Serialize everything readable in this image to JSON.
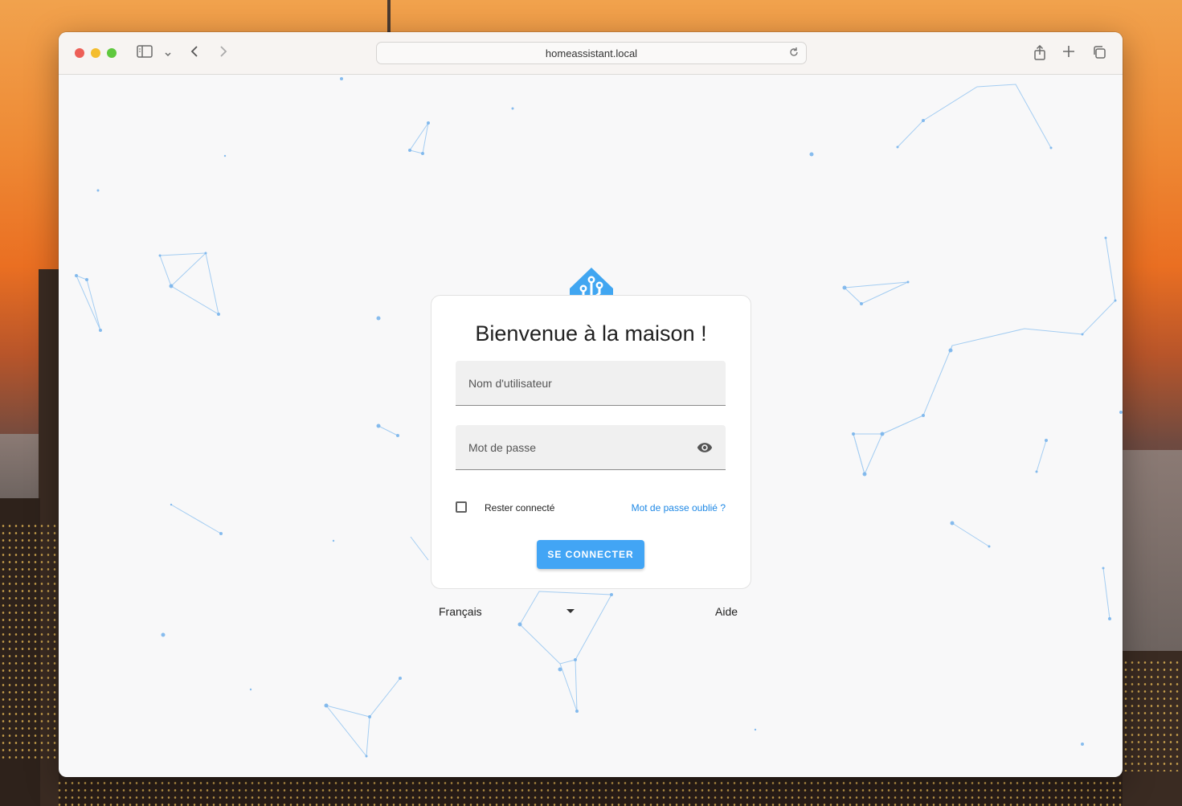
{
  "browser": {
    "url": "homeassistant.local",
    "traffic_lights": {
      "close": "#ed5f57",
      "minimize": "#f4bd2e",
      "zoom": "#5fc83e"
    }
  },
  "login": {
    "title": "Bienvenue à la maison !",
    "username_label": "Nom d'utilisateur",
    "password_label": "Mot de passe",
    "remember_label": "Rester connecté",
    "forgot_link": "Mot de passe oublié ?",
    "submit_label": "SE CONNECTER"
  },
  "footer": {
    "language": "Français",
    "help": "Aide"
  },
  "theme": {
    "accent": "#42a5f5",
    "link": "#1e88e5",
    "logo": "#41a6f1"
  },
  "icons": {
    "logo": "home-assistant-logo-icon",
    "sidebar": "sidebar-icon",
    "back": "chevron-left-icon",
    "forward": "chevron-right-icon",
    "share": "share-icon",
    "new_tab": "plus-icon",
    "tabs": "tabs-overview-icon",
    "reload": "reload-icon",
    "reveal": "eye-icon",
    "dropdown": "caret-down-icon"
  }
}
